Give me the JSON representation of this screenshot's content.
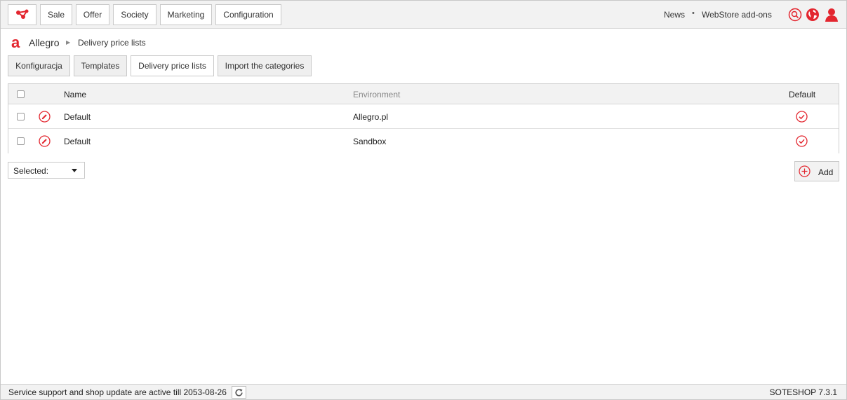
{
  "topbar": {
    "logo_icon": "share-nodes-icon",
    "nav": [
      {
        "label": "Sale"
      },
      {
        "label": "Offer"
      },
      {
        "label": "Society"
      },
      {
        "label": "Marketing"
      },
      {
        "label": "Configuration"
      }
    ],
    "links": {
      "news": "News",
      "separator": "•",
      "addons": "WebStore add-ons"
    },
    "icons": [
      "search-icon",
      "globe-icon",
      "user-icon"
    ],
    "accent_color": "#e3262f"
  },
  "breadcrumb": {
    "root": "Allegro",
    "separator": "▶",
    "current": "Delivery price lists"
  },
  "tabs": [
    {
      "label": "Konfiguracja"
    },
    {
      "label": "Templates"
    },
    {
      "label": "Delivery price lists",
      "active": true
    },
    {
      "label": "Import the categories"
    }
  ],
  "table": {
    "columns": {
      "name": "Name",
      "environment": "Environment",
      "default": "Default"
    },
    "rows": [
      {
        "name": "Default",
        "environment": "Allegro.pl",
        "is_default": true
      },
      {
        "name": "Default",
        "environment": "Sandbox",
        "is_default": true
      }
    ]
  },
  "actions": {
    "selected_label": "Selected:",
    "add_label": "Add"
  },
  "status": {
    "text": "Service support and shop update are active till 2053-08-26",
    "version": "SOTESHOP 7.3.1"
  }
}
